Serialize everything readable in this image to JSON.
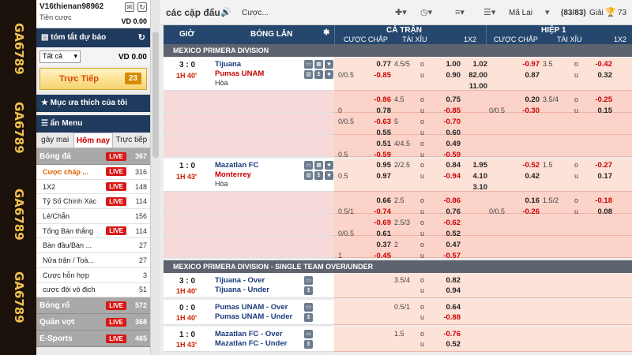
{
  "watermark": {
    "text": "GA6789"
  },
  "account": {
    "username": "V16thienan98962",
    "label": "Tiền cược",
    "balance": "VD 0.00"
  },
  "summary": {
    "label": "tóm tắt dự báo"
  },
  "filter": {
    "selected": "Tất cả",
    "balance": "VD 0.00"
  },
  "live": {
    "label": "Trực Tiếp",
    "count": "23"
  },
  "favorites": {
    "label": "Mục ưa thích của tôi"
  },
  "menu": {
    "label": "ẩn Menu"
  },
  "day_tabs": [
    {
      "label": "gày mai",
      "active": false
    },
    {
      "label": "Hôm nay",
      "active": true
    },
    {
      "label": "Trực tiếp",
      "active": false
    }
  ],
  "sports_top": {
    "name": "Bóng đá",
    "live": "LIVE",
    "count": "367"
  },
  "sub_items": [
    {
      "name": "Cược chấp ...",
      "live": "LIVE",
      "count": "316",
      "active": true
    },
    {
      "name": "1X2",
      "live": "LIVE",
      "count": "148",
      "active": false
    },
    {
      "name": "Tỷ Số Chính Xác",
      "live": "LIVE",
      "count": "114",
      "active": false
    },
    {
      "name": "Lẻ/Chẵn",
      "live": "",
      "count": "156",
      "active": false
    },
    {
      "name": "Tổng Bàn thắng",
      "live": "LIVE",
      "count": "114",
      "active": false
    },
    {
      "name": "Bàn đầu/Bàn ...",
      "live": "",
      "count": "27",
      "active": false
    },
    {
      "name": "Nửa trận / Toà...",
      "live": "",
      "count": "27",
      "active": false
    },
    {
      "name": "Cược hỗn hợp",
      "live": "",
      "count": "3",
      "active": false
    },
    {
      "name": "cược đội vô địch",
      "live": "",
      "count": "51",
      "active": false
    }
  ],
  "sports_bottom": [
    {
      "name": "Bóng rổ",
      "live": "LIVE",
      "count": "572"
    },
    {
      "name": "Quần vợt",
      "live": "LIVE",
      "count": "368"
    },
    {
      "name": "E-Sports",
      "live": "LIVE",
      "count": "465"
    }
  ],
  "toolbar": {
    "title": "các cặp đấu",
    "bet_label": "Cược...",
    "odds_type": "Mã Lai",
    "count": "(83/83)",
    "prize_label": "Giải",
    "prize_count": "73"
  },
  "headers": {
    "time": "GIỜ",
    "match": "BÓNG LĂN",
    "full_match": "CẢ TRẬN",
    "half": "HIỆP 1",
    "hcap": "CƯỢC CHẤP",
    "ou": "TÀI XỈU",
    "x12": "1X2",
    "hcap2": "CƯỢC CHẤP",
    "ou2": "TÀI XỈU",
    "x12b": "1X2"
  },
  "leagues": {
    "l1": "MEXICO PRIMERA DIVISION",
    "l2": "MEXICO PRIMERA DIVISION - SINGLE TEAM OVER/UNDER"
  },
  "matches": [
    {
      "score": "3 : 0",
      "time": "1H 40'",
      "home": "Tijuana",
      "away": "Pumas UNAM",
      "draw": "Hòa",
      "rows": [
        {
          "hcap": "",
          "h1": "0.77",
          "ou": "4.5/5",
          "ou_o": "o",
          "o1": "1.00",
          "x12": "1.02",
          "hhcap": "",
          "hh1": "-0.97",
          "hou": "3.5",
          "hou_o": "o",
          "ho1": "-0.42"
        },
        {
          "hcap": "0/0.5",
          "h1": "-0.85",
          "ou": "",
          "ou_o": "u",
          "o1": "0.90",
          "x12": "82.00",
          "hhcap": "",
          "hh1": "0.87",
          "hou": "",
          "hou_o": "u",
          "ho1": "0.32"
        },
        {
          "hcap": "",
          "h1": "",
          "ou": "",
          "ou_o": "",
          "o1": "",
          "x12": "11.00",
          "hhcap": "",
          "hh1": "",
          "hou": "",
          "hou_o": "",
          "ho1": ""
        },
        {
          "hcap": "",
          "h1": "-0.86",
          "ou": "4.5",
          "ou_o": "o",
          "o1": "0.75",
          "x12": "",
          "hhcap": "",
          "hh1": "0.20",
          "hou": "3.5/4",
          "hou_o": "o",
          "ho1": "-0.25"
        },
        {
          "hcap": "0",
          "h1": "0.78",
          "ou": "",
          "ou_o": "u",
          "o1": "-0.85",
          "x12": "",
          "hhcap": "0/0.5",
          "hh1": "-0.30",
          "hou": "",
          "hou_o": "u",
          "ho1": "0.15"
        },
        {
          "hcap": "0/0.5",
          "h1": "-0.63",
          "ou": "5",
          "ou_o": "o",
          "o1": "-0.70",
          "x12": "",
          "hhcap": "",
          "hh1": "",
          "hou": "",
          "hou_o": "",
          "ho1": ""
        },
        {
          "hcap": "",
          "h1": "0.55",
          "ou": "",
          "ou_o": "u",
          "o1": "0.60",
          "x12": "",
          "hhcap": "",
          "hh1": "",
          "hou": "",
          "hou_o": "",
          "ho1": ""
        },
        {
          "hcap": "",
          "h1": "0.51",
          "ou": "4/4.5",
          "ou_o": "o",
          "o1": "0.49",
          "x12": "",
          "hhcap": "",
          "hh1": "",
          "hou": "",
          "hou_o": "",
          "ho1": ""
        },
        {
          "hcap": "0.5",
          "h1": "-0.59",
          "ou": "",
          "ou_o": "u",
          "o1": "-0.59",
          "x12": "",
          "hhcap": "",
          "hh1": "",
          "hou": "",
          "hou_o": "",
          "ho1": ""
        }
      ]
    },
    {
      "score": "1 : 0",
      "time": "1H 43'",
      "home": "Mazatlan FC",
      "away": "Monterrey",
      "draw": "Hòa",
      "rows": [
        {
          "hcap": "",
          "h1": "0.95",
          "ou": "2/2.5",
          "ou_o": "o",
          "o1": "0.84",
          "x12": "1.95",
          "hhcap": "",
          "hh1": "-0.52",
          "hou": "1.5",
          "hou_o": "o",
          "ho1": "-0.27"
        },
        {
          "hcap": "0.5",
          "h1": "0.97",
          "ou": "",
          "ou_o": "u",
          "o1": "-0.94",
          "x12": "4.10",
          "hhcap": "",
          "hh1": "0.42",
          "hou": "",
          "hou_o": "u",
          "ho1": "0.17"
        },
        {
          "hcap": "",
          "h1": "",
          "ou": "",
          "ou_o": "",
          "o1": "",
          "x12": "3.10",
          "hhcap": "",
          "hh1": "",
          "hou": "",
          "hou_o": "",
          "ho1": ""
        },
        {
          "hcap": "",
          "h1": "0.66",
          "ou": "2.5",
          "ou_o": "o",
          "o1": "-0.86",
          "x12": "",
          "hhcap": "",
          "hh1": "0.16",
          "hou": "1.5/2",
          "hou_o": "o",
          "ho1": "-0.18"
        },
        {
          "hcap": "0.5/1",
          "h1": "-0.74",
          "ou": "",
          "ou_o": "u",
          "o1": "0.76",
          "x12": "",
          "hhcap": "0/0.5",
          "hh1": "-0.26",
          "hou": "",
          "hou_o": "u",
          "ho1": "0.08"
        },
        {
          "hcap": "",
          "h1": "-0.69",
          "ou": "2.5/3",
          "ou_o": "o",
          "o1": "-0.62",
          "x12": "",
          "hhcap": "",
          "hh1": "",
          "hou": "",
          "hou_o": "",
          "ho1": ""
        },
        {
          "hcap": "0/0.5",
          "h1": "0.61",
          "ou": "",
          "ou_o": "u",
          "o1": "0.52",
          "x12": "",
          "hhcap": "",
          "hh1": "",
          "hou": "",
          "hou_o": "",
          "ho1": ""
        },
        {
          "hcap": "",
          "h1": "0.37",
          "ou": "2",
          "ou_o": "o",
          "o1": "0.47",
          "x12": "",
          "hhcap": "",
          "hh1": "",
          "hou": "",
          "hou_o": "",
          "ho1": ""
        },
        {
          "hcap": "1",
          "h1": "-0.45",
          "ou": "",
          "ou_o": "u",
          "o1": "-0.57",
          "x12": "",
          "hhcap": "",
          "hh1": "",
          "hou": "",
          "hou_o": "",
          "ho1": ""
        }
      ]
    }
  ],
  "single_team": [
    {
      "score": "3 : 0",
      "time": "1H 40'",
      "over": "Tijuana - Over",
      "under": "Tijuana - Under",
      "ou": "3.5/4",
      "o_o": "o",
      "o1": "0.82",
      "u_u": "u",
      "u1": "0.94"
    },
    {
      "score": "0 : 0",
      "time": "1H 40'",
      "over": "Pumas UNAM - Over",
      "under": "Pumas UNAM - Under",
      "ou": "0.5/1",
      "o_o": "o",
      "o1": "0.64",
      "u_u": "u",
      "u1": "-0.88"
    },
    {
      "score": "1 : 0",
      "time": "1H 43'",
      "over": "Mazatlan FC - Over",
      "under": "Mazatlan FC - Under",
      "ou": "1.5",
      "o_o": "o",
      "o1": "-0.76",
      "u_u": "u",
      "u1": "0.52"
    }
  ]
}
